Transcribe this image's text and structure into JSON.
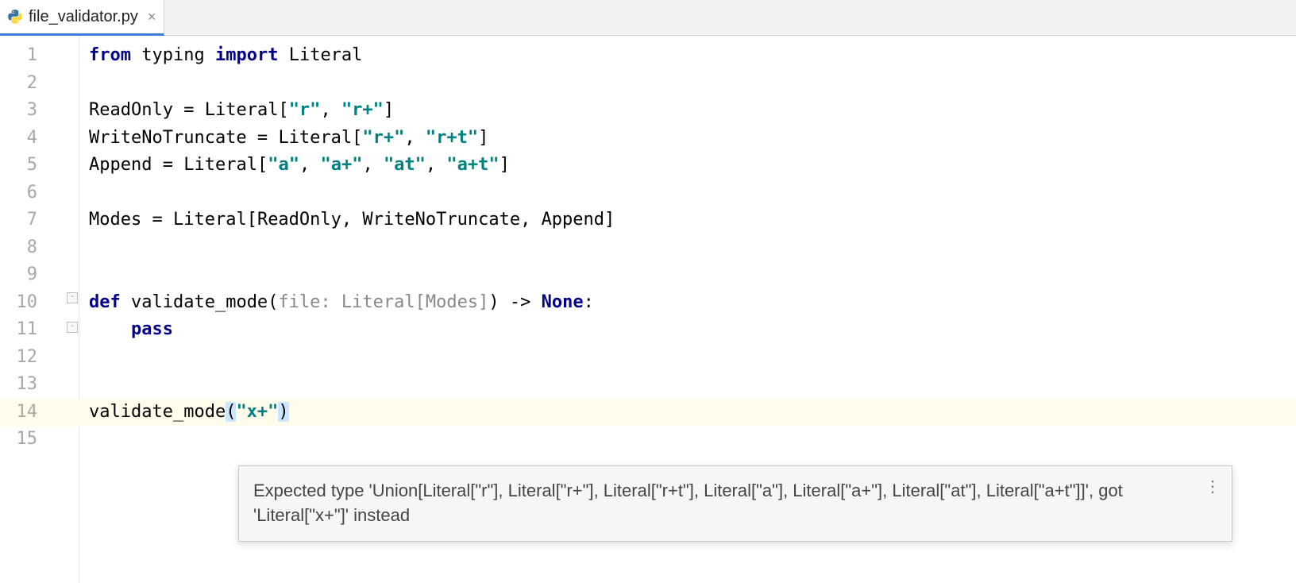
{
  "tab": {
    "filename": "file_validator.py",
    "close_glyph": "×"
  },
  "line_numbers": [
    "1",
    "2",
    "3",
    "4",
    "5",
    "6",
    "7",
    "8",
    "9",
    "10",
    "11",
    "12",
    "13",
    "14",
    "15"
  ],
  "code": {
    "l1": {
      "from": "from",
      "typing": "typing",
      "import": "import",
      "literal": "Literal"
    },
    "l3": {
      "name": "ReadOnly",
      "eq": " = ",
      "lit": "Literal[",
      "s1": "\"r\"",
      "c1": ", ",
      "s2": "\"r+\"",
      "close": "]"
    },
    "l4": {
      "name": "WriteNoTruncate",
      "eq": " = ",
      "lit": "Literal[",
      "s1": "\"r+\"",
      "c1": ", ",
      "s2": "\"r+t\"",
      "close": "]"
    },
    "l5": {
      "name": "Append",
      "eq": " = ",
      "lit": "Literal[",
      "s1": "\"a\"",
      "c1": ", ",
      "s2": "\"a+\"",
      "c2": ", ",
      "s3": "\"at\"",
      "c3": ", ",
      "s4": "\"a+t\"",
      "close": "]"
    },
    "l7": {
      "name": "Modes",
      "eq": " = ",
      "lit": "Literal[ReadOnly, WriteNoTruncate, Append]"
    },
    "l10": {
      "def": "def",
      "fn": " validate_mode(",
      "param": "file",
      "hint": ": Literal[Modes]",
      "arrow": ") -> ",
      "none": "None",
      "colon": ":"
    },
    "l11": {
      "indent": "    ",
      "pass": "pass"
    },
    "l14": {
      "call": "validate_mode",
      "open": "(",
      "arg": "\"x+\"",
      "close": ")"
    }
  },
  "tooltip": {
    "text": "Expected type 'Union[Literal[\"r\"], Literal[\"r+\"], Literal[\"r+t\"], Literal[\"a\"], Literal[\"a+\"], Literal[\"at\"], Literal[\"a+t\"]]', got 'Literal[\"x+\"]' instead",
    "more_glyph": "⋮"
  }
}
